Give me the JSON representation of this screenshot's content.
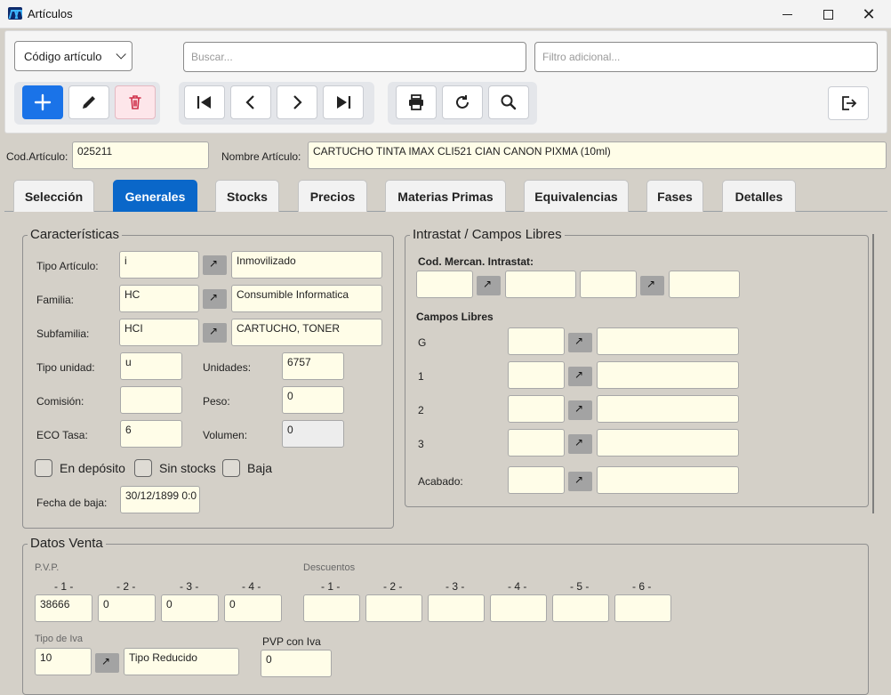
{
  "window": {
    "title": "Artículos"
  },
  "toolbar": {
    "combo_value": "Código artículo",
    "search_placeholder": "Buscar...",
    "filter_placeholder": "Filtro adicional..."
  },
  "article": {
    "code_label": "Cod.Artículo:",
    "code_value": "025211",
    "name_label": "Nombre Artículo:",
    "name_value": "CARTUCHO TINTA IMAX CLI521 CIAN CANON PIXMA (10ml)"
  },
  "tabs": [
    "Selección",
    "Generales",
    "Stocks",
    "Precios",
    "Materias Primas",
    "Equivalencias",
    "Fases",
    "Detalles"
  ],
  "caracteristicas": {
    "legend": "Características",
    "tipo_articulo": {
      "label": "Tipo Artículo:",
      "code": "i",
      "desc": "Inmovilizado"
    },
    "familia": {
      "label": "Familia:",
      "code": "HC",
      "desc": "Consumible Informatica"
    },
    "subfamilia": {
      "label": "Subfamilia:",
      "code": "HCI",
      "desc": "CARTUCHO, TONER"
    },
    "tipo_unidad": {
      "label": "Tipo unidad:",
      "value": "u"
    },
    "unidades": {
      "label": "Unidades:",
      "value": "6757"
    },
    "comision": {
      "label": "Comisión:",
      "value": ""
    },
    "peso": {
      "label": "Peso:",
      "value": "0"
    },
    "eco_tasa": {
      "label": "ECO Tasa:",
      "value": "6"
    },
    "volumen": {
      "label": "Volumen:",
      "value": "0"
    },
    "en_deposito": "En depósito",
    "sin_stocks": "Sin stocks",
    "baja": "Baja",
    "fecha_baja": {
      "label": "Fecha de baja:",
      "value": "30/12/1899 0:0"
    }
  },
  "intrastat": {
    "legend": "Intrastat / Campos Libres",
    "cod_mercan_label": "Cod. Mercan. Intrastat:",
    "campos_libres_label": "Campos Libres",
    "rows": [
      "G",
      "1",
      "2",
      "3",
      "Acabado:"
    ]
  },
  "datos_venta": {
    "legend": "Datos Venta",
    "pvp_label": "P.V.P.",
    "pvp_headers": [
      "- 1 -",
      "- 2 -",
      "- 3 -",
      "- 4 -"
    ],
    "pvp_values": [
      "38666",
      "0",
      "0",
      "0"
    ],
    "descuentos_label": "Descuentos",
    "desc_headers": [
      "- 1 -",
      "- 2 -",
      "- 3 -",
      "- 4 -",
      "- 5 -",
      "- 6 -"
    ],
    "tipo_iva_label": "Tipo de Iva",
    "tipo_iva_code": "10",
    "tipo_iva_desc": "Tipo Reducido",
    "pvp_iva_label": "PVP con Iva",
    "pvp_iva_value": "0"
  }
}
